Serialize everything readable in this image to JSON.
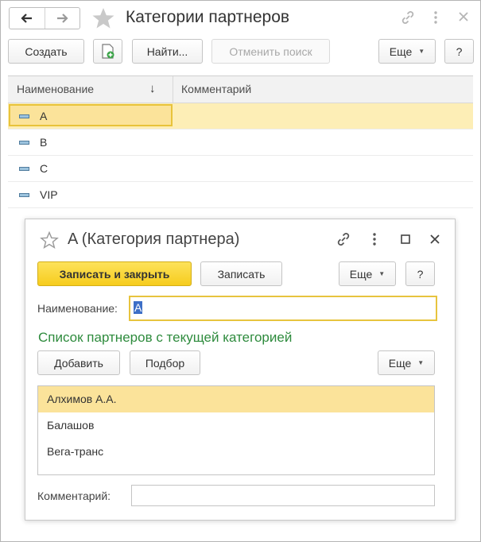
{
  "window": {
    "title": "Категории партнеров"
  },
  "toolbar": {
    "create_label": "Создать",
    "find_label": "Найти...",
    "cancel_search_label": "Отменить поиск",
    "more_label": "Еще",
    "help_label": "?"
  },
  "grid": {
    "columns": [
      "Наименование",
      "Комментарий"
    ],
    "sort_indicator": "↓",
    "rows": [
      {
        "name": "A",
        "comment": ""
      },
      {
        "name": "B",
        "comment": ""
      },
      {
        "name": "C",
        "comment": ""
      },
      {
        "name": "VIP",
        "comment": ""
      }
    ],
    "selected_index": 0
  },
  "dialog": {
    "title": "A (Категория партнера)",
    "save_close_label": "Записать и закрыть",
    "save_label": "Записать",
    "more_label": "Еще",
    "help_label": "?",
    "name_label": "Наименование:",
    "name_value": "A",
    "section_title": "Список партнеров с текущей категорией",
    "add_label": "Добавить",
    "pick_label": "Подбор",
    "list_more_label": "Еще",
    "partners": [
      "Алхимов А.А.",
      "Балашов",
      "Вега-транс"
    ],
    "selected_partner_index": 0,
    "comment_label": "Комментарий:",
    "comment_value": ""
  },
  "colors": {
    "accent_yellow": "#f6cc1d",
    "selection": "#fbe39a",
    "section_green": "#2e8b3d",
    "text_selection": "#3d6fc7"
  },
  "icons": [
    "back-arrow-icon",
    "forward-arrow-icon",
    "star-icon",
    "link-icon",
    "more-vert-icon",
    "close-icon",
    "add-document-icon",
    "list-item-icon",
    "maximize-icon"
  ]
}
